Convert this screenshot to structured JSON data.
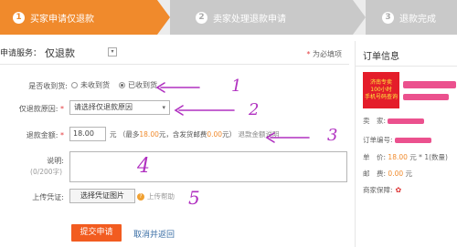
{
  "steps": [
    {
      "num": "1",
      "label": "买家申请仅退款"
    },
    {
      "num": "2",
      "label": "卖家处理退款申请"
    },
    {
      "num": "3",
      "label": "退款完成"
    }
  ],
  "form": {
    "service_label": "申请服务：",
    "service_value": "仅退款",
    "select_caret": "▾",
    "required_note": "为必填项",
    "received": {
      "label": "是否收到货:",
      "options": [
        "未收到货",
        "已收到货"
      ]
    },
    "reason": {
      "label": "仅退款原因:",
      "placeholder": "请选择仅退款原因",
      "caret": "▾"
    },
    "amount": {
      "label": "退款金额:",
      "value": "18.00",
      "unit": "元",
      "note_prefix": "（最多",
      "max": "18.00",
      "note_mid": "元，含发货邮费",
      "postage": "0.00",
      "note_suffix": "元）",
      "link": "退款金额说明"
    },
    "description": {
      "label": "说明:",
      "chars": "(0/200字)"
    },
    "upload": {
      "label": "上传凭证:",
      "button": "选择凭证图片",
      "help": "上传帮助"
    },
    "submit": "提交申请",
    "cancel": "取消并返回"
  },
  "annotations": [
    "1",
    "2",
    "3",
    "4",
    "5"
  ],
  "order": {
    "title": "订单信息",
    "thumb_text": [
      "济南专卖",
      "100小时",
      "手机号码查询"
    ],
    "seller_label": "卖　家:",
    "order_no_label": "订单编号:",
    "price_label": "单　价:",
    "price_value": "18.00",
    "price_suffix": "元 * 1(数量)",
    "postage_label": "邮　费:",
    "postage_value": "0.00",
    "postage_unit": "元",
    "guarantee_label": "商家保障:"
  },
  "colors": {
    "accent": "#f08a2c",
    "submit": "#f25c20",
    "annotation": "#b030c0",
    "redaction": "#e8327a"
  }
}
